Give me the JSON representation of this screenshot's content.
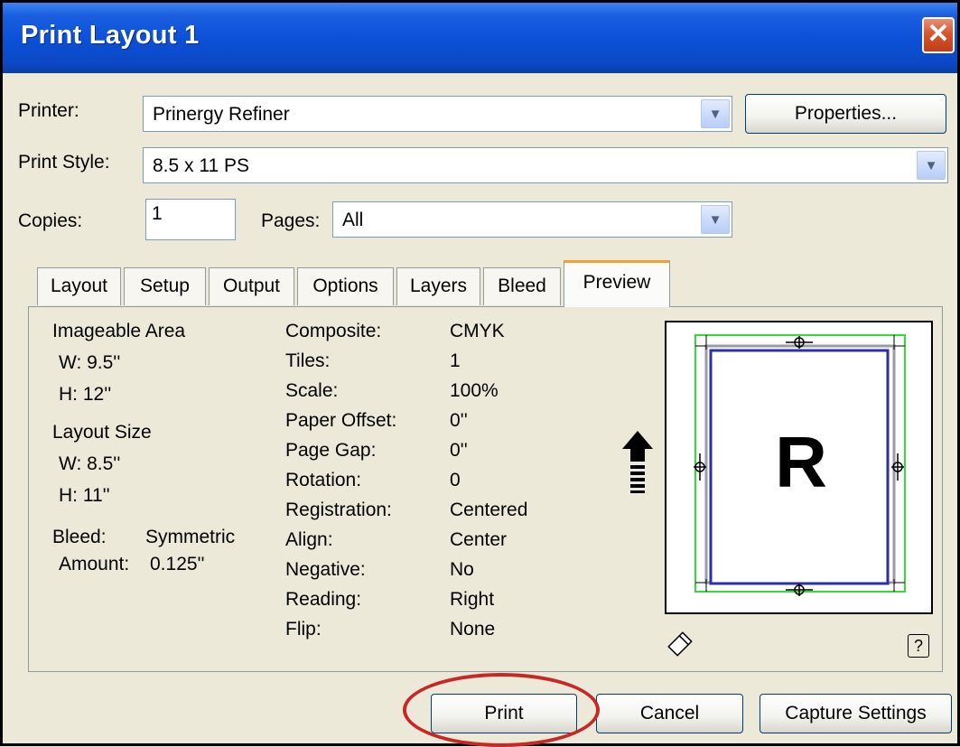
{
  "window": {
    "title": "Print Layout 1",
    "close_symbol": "✕"
  },
  "printer": {
    "label": "Printer:",
    "value": "Prinergy Refiner",
    "properties_button": "Properties..."
  },
  "print_style": {
    "label": "Print Style:",
    "value": "8.5 x 11 PS"
  },
  "copies": {
    "label": "Copies:",
    "value": "1"
  },
  "pages": {
    "label": "Pages:",
    "value": "All"
  },
  "tabs": [
    "Layout",
    "Setup",
    "Output",
    "Options",
    "Layers",
    "Bleed",
    "Preview"
  ],
  "active_tab": "Preview",
  "preview": {
    "imageable_area": {
      "title": "Imageable Area",
      "w": "W: 9.5''",
      "h": "H: 12''"
    },
    "layout_size": {
      "title": "Layout Size",
      "w": "W: 8.5''",
      "h": "H: 11''"
    },
    "bleed": {
      "label": "Bleed:",
      "value": "Symmetric",
      "amount_label": "Amount:",
      "amount_value": "0.125''"
    },
    "settings": [
      {
        "label": "Composite:",
        "value": "CMYK"
      },
      {
        "label": "Tiles:",
        "value": "1"
      },
      {
        "label": "Scale:",
        "value": "100%"
      },
      {
        "label": "Paper Offset:",
        "value": "0''"
      },
      {
        "label": "Page Gap:",
        "value": "0''"
      },
      {
        "label": "Rotation:",
        "value": "0"
      },
      {
        "label": "Registration:",
        "value": "Centered"
      },
      {
        "label": "Align:",
        "value": "Center"
      },
      {
        "label": "Negative:",
        "value": "No"
      },
      {
        "label": "Reading:",
        "value": "Right"
      },
      {
        "label": "Flip:",
        "value": "None"
      }
    ],
    "page_letter": "R",
    "help_symbol": "?",
    "icons": [
      "orientation-arrow-icon",
      "rotate-icon",
      "help-icon"
    ]
  },
  "buttons": {
    "print": "Print",
    "cancel": "Cancel",
    "capture": "Capture Settings"
  },
  "colors": {
    "titlebar": "#0a4fd6",
    "highlight_circle": "#c62828",
    "page_border": "#2b2fa8",
    "imageable_border": "#33dd33",
    "tab_accent": "#f2a12e"
  }
}
